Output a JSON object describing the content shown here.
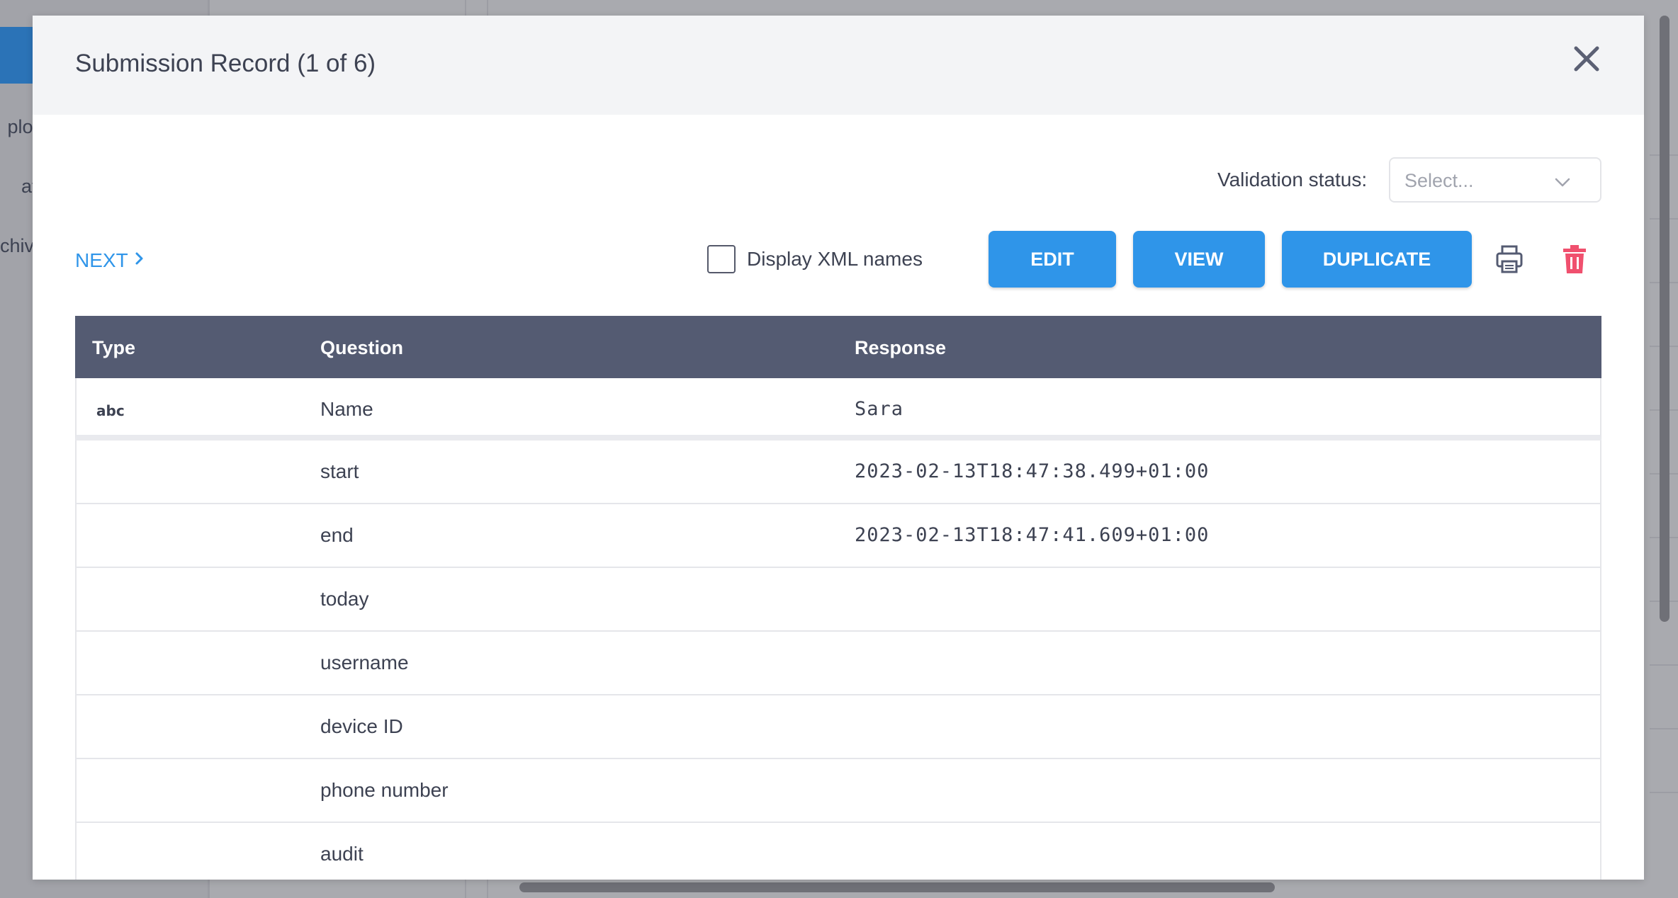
{
  "background": {
    "nav_items": [
      "ploy",
      "aft",
      "chive"
    ]
  },
  "modal": {
    "title": "Submission Record (1 of 6)",
    "close_icon": "close-icon",
    "validation": {
      "label": "Validation status:",
      "placeholder": "Select..."
    },
    "next_label": "NEXT",
    "display_xml_label": "Display XML names",
    "buttons": {
      "edit": "EDIT",
      "view": "VIEW",
      "duplicate": "DUPLICATE"
    },
    "colors": {
      "accent": "#2f95e9",
      "table_header": "#545b72",
      "delete": "#f0506e"
    },
    "table": {
      "headers": {
        "type": "Type",
        "question": "Question",
        "response": "Response"
      },
      "rows": [
        {
          "type": "abc",
          "question": "Name",
          "response": "Sara"
        },
        {
          "type": "",
          "question": "start",
          "response": "2023-02-13T18:47:38.499+01:00"
        },
        {
          "type": "",
          "question": "end",
          "response": "2023-02-13T18:47:41.609+01:00"
        },
        {
          "type": "",
          "question": "today",
          "response": ""
        },
        {
          "type": "",
          "question": "username",
          "response": ""
        },
        {
          "type": "",
          "question": "device ID",
          "response": ""
        },
        {
          "type": "",
          "question": "phone number",
          "response": ""
        },
        {
          "type": "",
          "question": "audit",
          "response": ""
        }
      ]
    }
  }
}
